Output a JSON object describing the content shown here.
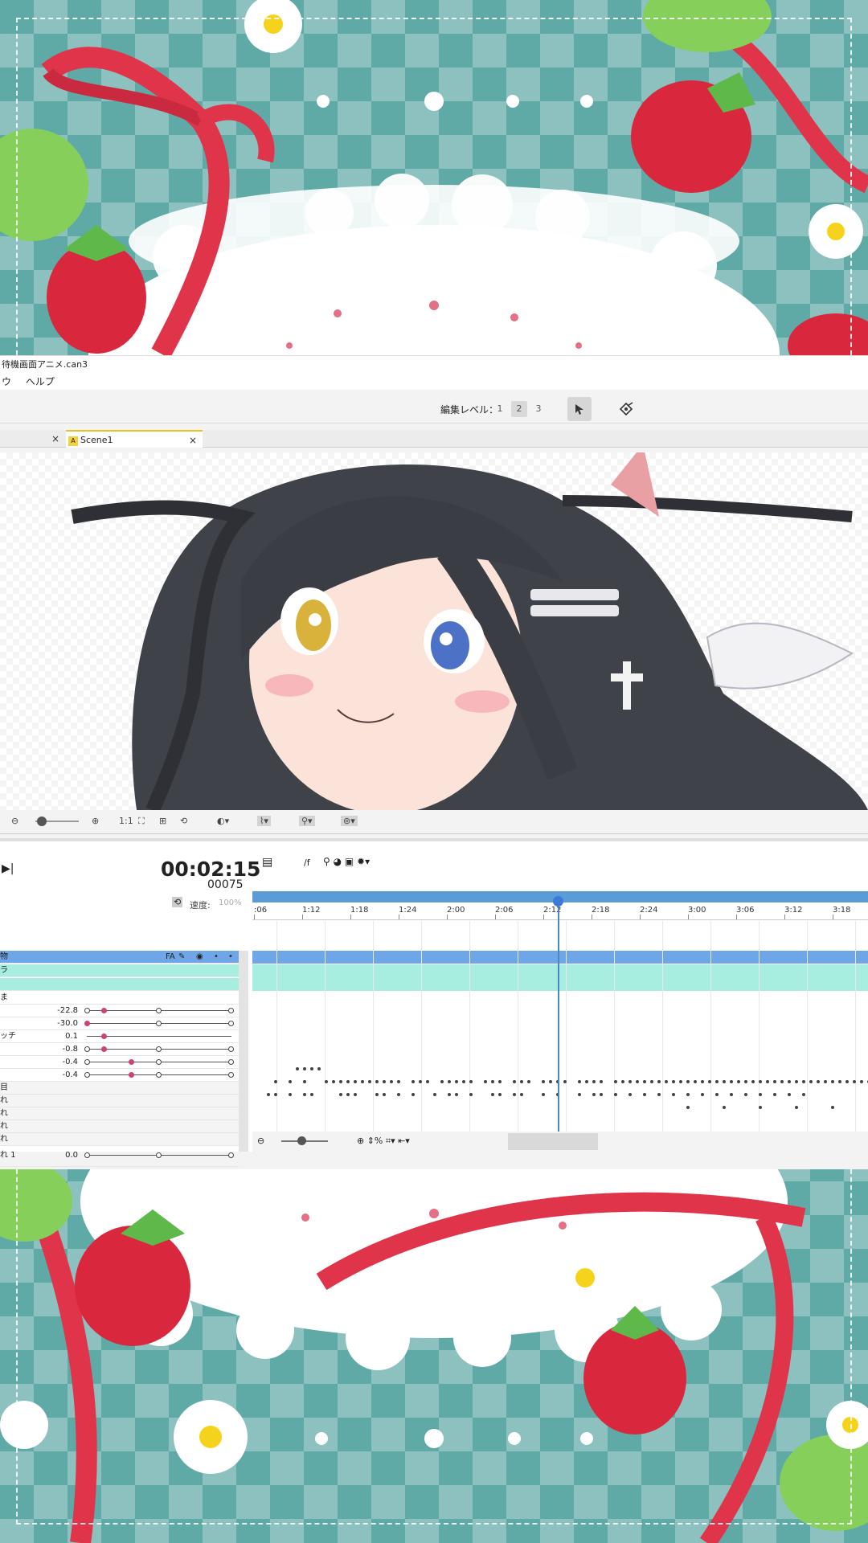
{
  "app": {
    "title": "待機画面アニメ.can3",
    "menu": [
      "ウ",
      "ヘルプ"
    ]
  },
  "toolbar": {
    "edit_level_label": "編集レベル：",
    "levels": [
      "1",
      "2",
      "3"
    ],
    "selected_level": "2"
  },
  "tabs": [
    {
      "label": "",
      "active": false
    },
    {
      "label": "Scene1",
      "active": true
    }
  ],
  "viewbar": {
    "zoom_ratio": "1:1"
  },
  "timeline": {
    "timecode": "00:02:15",
    "frame": "00075",
    "speed_label": "速度:",
    "speed_value": "100%",
    "ruler_ticks": [
      ":06",
      "1:12",
      "1:18",
      "1:24",
      "2:00",
      "2:06",
      "2:12",
      "2:18",
      "2:24",
      "3:00",
      "3:06",
      "3:12",
      "3:18"
    ],
    "tracks": [
      {
        "name": "物",
        "badge": "FA",
        "style": "selected"
      },
      {
        "name": "ラ",
        "badge": "",
        "style": "teal"
      },
      {
        "name": "",
        "badge": "",
        "style": "teal"
      }
    ],
    "params": [
      {
        "name": "ま",
        "value": ""
      },
      {
        "name": "",
        "value": "-22.8"
      },
      {
        "name": "",
        "value": "-30.0"
      },
      {
        "name": "ッチ",
        "value": "0.1"
      },
      {
        "name": "",
        "value": "-0.8"
      },
      {
        "name": "",
        "value": "-0.4"
      },
      {
        "name": "",
        "value": "-0.4"
      },
      {
        "name": "目",
        "value": ""
      },
      {
        "name": "れ",
        "value": ""
      },
      {
        "name": "れ",
        "value": ""
      },
      {
        "name": "れ",
        "value": ""
      },
      {
        "name": "れ",
        "value": ""
      },
      {
        "name": "れ 1",
        "value": "0.0"
      }
    ]
  },
  "colors": {
    "accent": "#3a7bd5",
    "selected_track": "#6ea6e8",
    "teal_track": "#a7eee0",
    "keyframe_on": "#d04070",
    "background_teal": "#5fa9a6",
    "ribbon": "#e0344a",
    "strawberry": "#d9283d"
  },
  "icons": [
    "close-icon",
    "pointer-icon",
    "transform-icon",
    "zoom-out-icon",
    "zoom-in-icon",
    "fit-icon",
    "play-icon",
    "loop-icon",
    "eye-icon",
    "pen-icon"
  ]
}
